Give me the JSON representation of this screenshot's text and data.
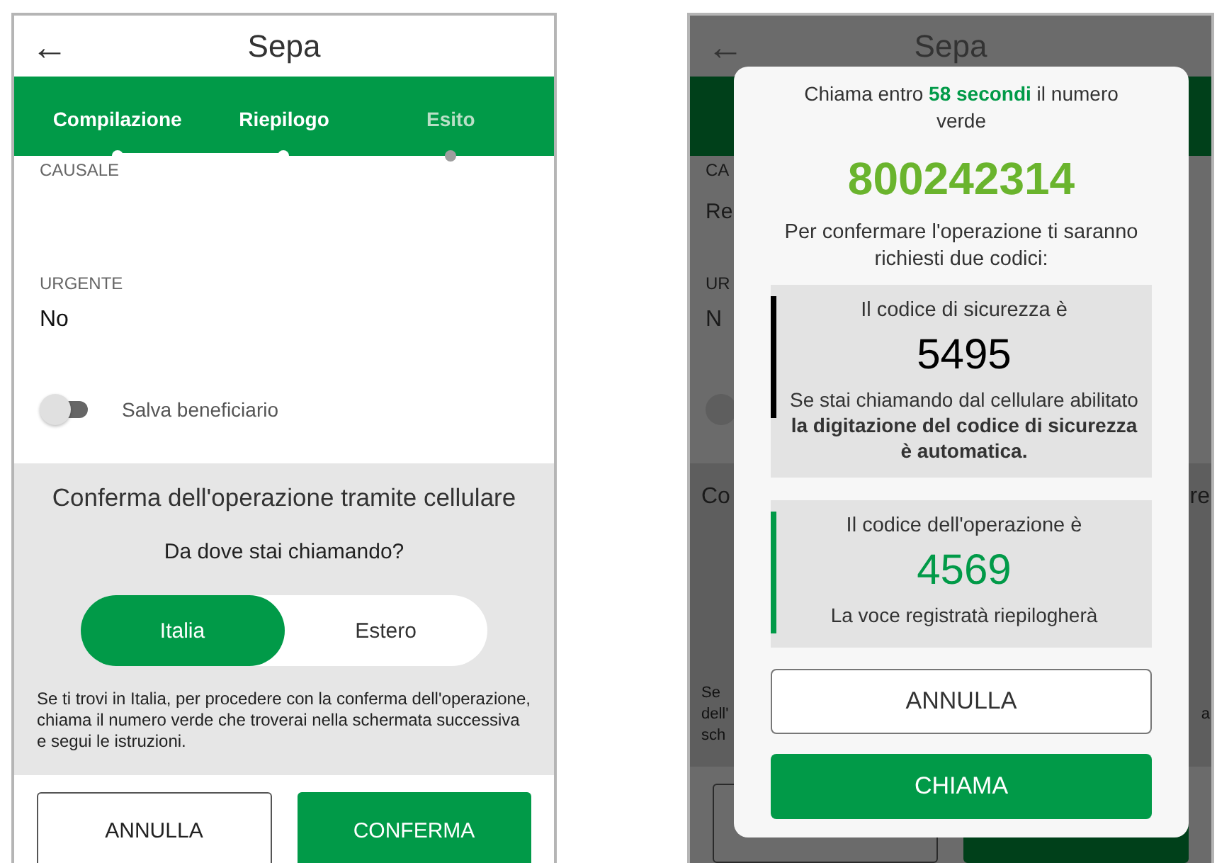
{
  "left_screen": {
    "header": {
      "back": "←",
      "title": "Sepa"
    },
    "steps": [
      {
        "label": "Compilazione",
        "done": true
      },
      {
        "label": "Riepilogo",
        "done": true
      },
      {
        "label": "Esito",
        "done": false
      }
    ],
    "causale": {
      "label": "CAUSALE"
    },
    "urgente": {
      "label": "URGENTE",
      "value": "No"
    },
    "save_toggle": {
      "label": "Salva beneficiario",
      "on": false
    },
    "confirm_section": {
      "title": "Conferma dell'operazione tramite cellulare",
      "question": "Da dove stai chiamando?",
      "options": [
        {
          "label": "Italia",
          "selected": true
        },
        {
          "label": "Estero",
          "selected": false
        }
      ],
      "note": "Se ti trovi in Italia, per procedere con la conferma dell'operazione, chiama il numero verde che troverai nella schermata successiva e segui le istruzioni."
    },
    "buttons": [
      {
        "label": "ANNULLA",
        "kind": "outline"
      },
      {
        "label": "CONFERMA",
        "kind": "primary"
      }
    ]
  },
  "right_screen": {
    "header": {
      "back": "←",
      "title": "Sepa"
    },
    "causale": {
      "label": "CA",
      "value": "Re"
    },
    "urgente": {
      "label": "UR",
      "value": "N"
    },
    "save_toggle": {
      "on": false
    },
    "confirm_section": {
      "title_left": "Co",
      "title_right": "re",
      "note_lines": [
        {
          "left": "Se"
        },
        {
          "left": "dell'",
          "right": "a"
        },
        {
          "left": "sch"
        }
      ]
    },
    "buttons": [
      {
        "kind": "outline"
      },
      {
        "kind": "primary"
      }
    ],
    "modal": {
      "message": "Chiama entro **58 secondi** il numero verde",
      "phone_number": "800242314",
      "instructions": "Per confermare l'operazione ti saranno richiesti due codici:",
      "codes": [
        {
          "label": "Il codice di sicurezza è",
          "code": "5495",
          "color": "#000000",
          "note": "Se stai chiamando dal cellulare abilitato **la digitazione del codice di sicurezza è automatica.**"
        },
        {
          "label": "Il codice dell'operazione è",
          "code": "4569",
          "color": "#019a48",
          "note": "La voce registratà riepilogherà"
        }
      ],
      "buttons": [
        {
          "label": "ANNULLA",
          "kind": "outline"
        },
        {
          "label": "CHIAMA",
          "kind": "primary"
        }
      ]
    }
  }
}
